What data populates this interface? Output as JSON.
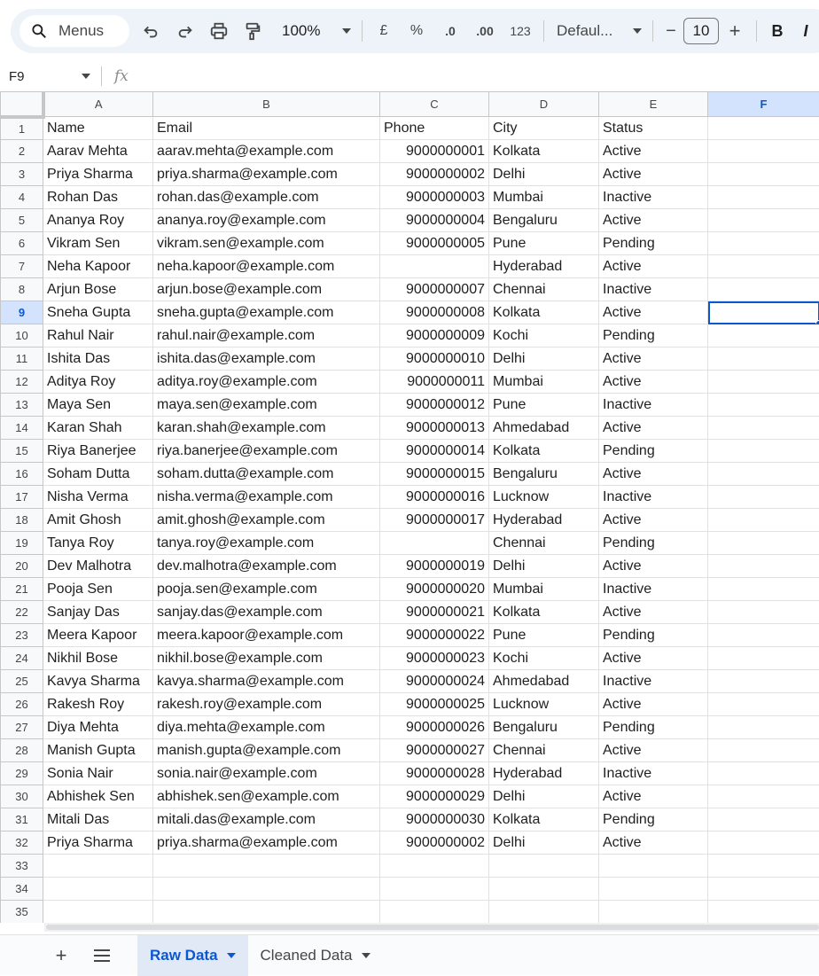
{
  "toolbar": {
    "menus_label": "Menus",
    "zoom": "100%",
    "currency": "£",
    "percent": "%",
    "dec_decrease": ".0",
    "dec_increase": ".00",
    "number_format": "123",
    "font": "Defaul...",
    "font_size": "10",
    "bold": "B",
    "italic": "I",
    "minus": "−",
    "plus": "+"
  },
  "formula_bar": {
    "cell_ref": "F9",
    "fx": "fx"
  },
  "sheet": {
    "columns": [
      "A",
      "B",
      "C",
      "D",
      "E",
      "F"
    ],
    "header": [
      "Name",
      "Email",
      "Phone",
      "City",
      "Status"
    ],
    "rows": [
      [
        " Aarav Mehta",
        "aarav.mehta@example.com",
        "9000000001",
        "Kolkata",
        "Active"
      ],
      [
        "Priya Sharma",
        "priya.sharma@example.com",
        "9000000002",
        "Delhi",
        "Active"
      ],
      [
        " Rohan Das",
        "rohan.das@example.com",
        "9000000003",
        "Mumbai",
        "Inactive"
      ],
      [
        "Ananya Roy",
        "ananya.roy@example.com",
        "9000000004",
        "Bengaluru",
        "Active"
      ],
      [
        "Vikram Sen",
        "vikram.sen@example.com",
        "9000000005",
        "Pune",
        "Pending"
      ],
      [
        "Neha  Kapoor",
        "neha.kapoor@example.com",
        "",
        "Hyderabad",
        "Active"
      ],
      [
        "Arjun Bose",
        "arjun.bose@example.com",
        "9000000007",
        "Chennai",
        "Inactive"
      ],
      [
        "Sneha Gupta",
        "sneha.gupta@example.com",
        "9000000008",
        "Kolkata",
        "Active"
      ],
      [
        "Rahul Nair",
        "rahul.nair@example.com",
        "9000000009",
        "Kochi",
        "Pending"
      ],
      [
        "Ishita Das",
        "ishita.das@example.com",
        "9000000010",
        "Delhi",
        "Active"
      ],
      [
        "Aditya Roy",
        "aditya.roy@example.com",
        "9000000011",
        "Mumbai",
        "Active"
      ],
      [
        "Maya Sen",
        "maya.sen@example.com",
        "9000000012",
        "Pune",
        "Inactive"
      ],
      [
        "Karan Shah",
        "karan.shah@example.com",
        "9000000013",
        "Ahmedabad",
        "Active"
      ],
      [
        "Riya  Banerjee",
        "riya.banerjee@example.com",
        "9000000014",
        "Kolkata",
        "Pending"
      ],
      [
        "Soham Dutta",
        "soham.dutta@example.com",
        "9000000015",
        "Bengaluru",
        "Active"
      ],
      [
        "Nisha Verma",
        "nisha.verma@example.com",
        "9000000016",
        "Lucknow",
        "Inactive"
      ],
      [
        "Amit Ghosh",
        "amit.ghosh@example.com",
        "9000000017",
        "Hyderabad",
        "Active"
      ],
      [
        "Tanya Roy",
        "tanya.roy@example.com",
        "",
        "Chennai",
        "Pending"
      ],
      [
        " Dev Malhotra",
        "dev.malhotra@example.com",
        "9000000019",
        "Delhi",
        "Active"
      ],
      [
        "Pooja Sen",
        "pooja.sen@example.com",
        "9000000020",
        "Mumbai",
        "Inactive"
      ],
      [
        "Sanjay Das",
        "sanjay.das@example.com",
        "9000000021",
        "Kolkata",
        "Active"
      ],
      [
        "Meera Kapoor",
        "meera.kapoor@example.com",
        "9000000022",
        "Pune",
        "Pending"
      ],
      [
        "Nikhil Bose",
        "nikhil.bose@example.com",
        "9000000023",
        "Kochi",
        "Active"
      ],
      [
        "Kavya Sharma",
        "kavya.sharma@example.com",
        "9000000024",
        "Ahmedabad",
        "Inactive"
      ],
      [
        "Rakesh Roy",
        "rakesh.roy@example.com",
        "9000000025",
        "Lucknow",
        "Active"
      ],
      [
        "Diya Mehta",
        "diya.mehta@example.com",
        "9000000026",
        "Bengaluru",
        "Pending"
      ],
      [
        "Manish Gupta",
        "manish.gupta@example.com",
        "9000000027",
        "Chennai",
        "Active"
      ],
      [
        "Sonia Nair",
        "sonia.nair@example.com",
        "9000000028",
        "Hyderabad",
        "Inactive"
      ],
      [
        "Abhishek Sen",
        "abhishek.sen@example.com",
        "9000000029",
        "Delhi",
        "Active"
      ],
      [
        "Mitali Das",
        "mitali.das@example.com",
        "9000000030",
        "Kolkata",
        "Pending"
      ],
      [
        "Priya Sharma",
        "priya.sharma@example.com",
        "9000000002",
        "Delhi",
        "Active"
      ]
    ],
    "empty_row_numbers": [
      "33",
      "34",
      "35"
    ],
    "selected_column": "F",
    "selected_row": "9"
  },
  "tabs": {
    "items": [
      "Raw Data",
      "Cleaned Data"
    ],
    "active": "Raw Data"
  },
  "colors": {
    "accent": "#0b57d0",
    "selection_header": "#d3e3fd",
    "toolbar_bg": "#eef2f9"
  }
}
